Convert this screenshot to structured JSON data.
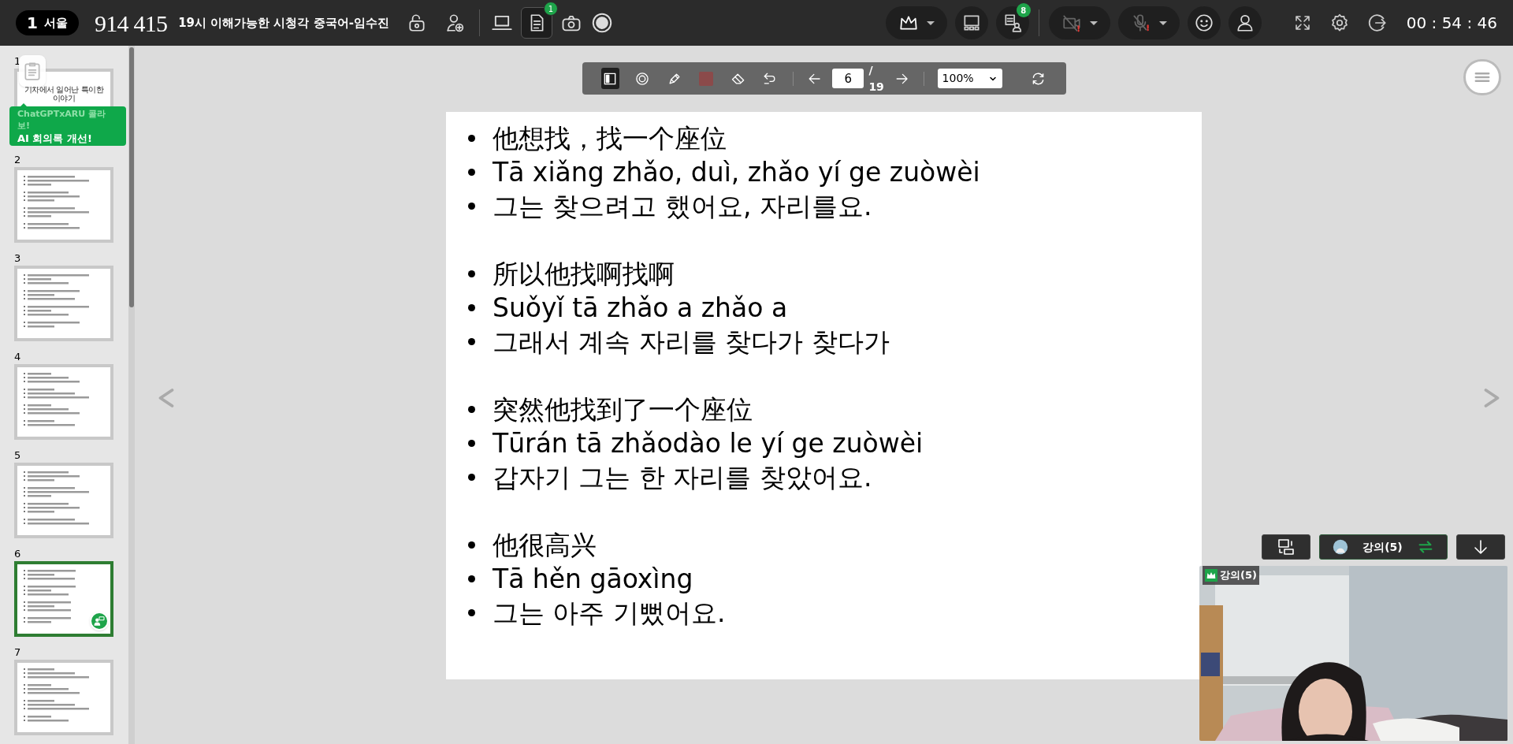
{
  "top_bar": {
    "room_number": "1",
    "room_name": "서울",
    "meeting_id": "914 415",
    "meeting_title": "19시 이해가능한 시청각 중국어-임수진",
    "notes_badge": "1",
    "participants_badge": "8",
    "timer": "00 : 54 : 46"
  },
  "slides_panel": {
    "thumbnails": [
      {
        "number": "1",
        "title": "기차에서 일어난 특이한 이야기",
        "selected": false
      },
      {
        "number": "2",
        "selected": false
      },
      {
        "number": "3",
        "selected": false
      },
      {
        "number": "4",
        "selected": false
      },
      {
        "number": "5",
        "selected": false
      },
      {
        "number": "6",
        "selected": true
      },
      {
        "number": "7",
        "selected": false
      }
    ],
    "promo": {
      "line_1": "ChatGPTxARU 콜라보!",
      "line_2": "AI 회의록 개선!"
    }
  },
  "slide_toolbar": {
    "tools": [
      {
        "kind": "panel",
        "selected": true
      },
      {
        "kind": "target",
        "selected": false
      },
      {
        "kind": "pen",
        "selected": false
      },
      {
        "kind": "color",
        "selected": false
      },
      {
        "kind": "eraser",
        "selected": false
      },
      {
        "kind": "undo",
        "selected": false
      }
    ],
    "page": "6",
    "total": "/ 19",
    "zoom": "100%"
  },
  "slide": {
    "groups": [
      {
        "lines": [
          "他想找，找一个座位",
          "Tā xiǎng zhǎo, duì, zhǎo yí ge zuòwèi",
          "그는 찾으려고 했어요, 자리를요."
        ]
      },
      {
        "lines": [
          "所以他找啊找啊",
          "Suǒyǐ tā zhǎo a zhǎo a",
          "그래서 계속 자리를 찾다가 찾다가"
        ]
      },
      {
        "lines": [
          "突然他找到了一个座位",
          "Tūrán tā zhǎodào le yí ge zuòwèi",
          "갑자기 그는 한 자리를 찾았어요."
        ]
      },
      {
        "lines": [
          "他很高兴",
          "Tā hěn gāoxìng",
          "그는 아주 기뻤어요."
        ]
      }
    ]
  },
  "video": {
    "switch_label": "강의(5)",
    "tile_label": "강의(5)"
  }
}
